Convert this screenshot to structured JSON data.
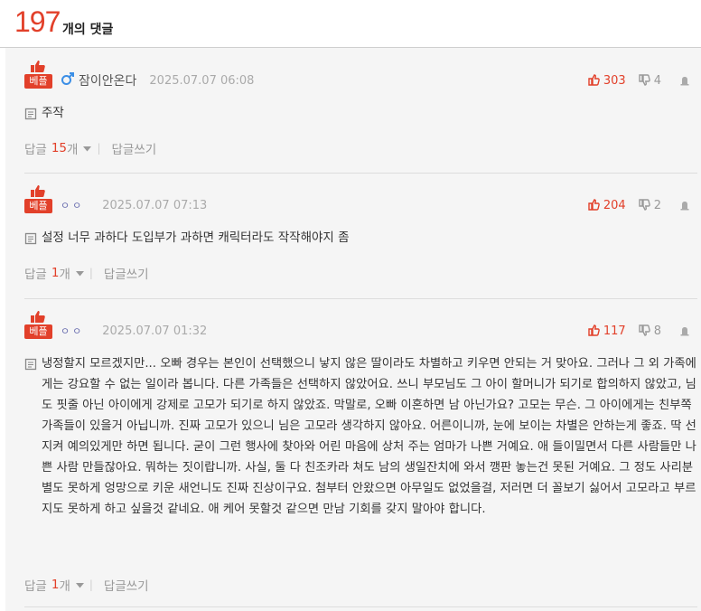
{
  "header": {
    "count": "197",
    "count_label": "개의 댓글"
  },
  "comments": [
    {
      "badge": "베플",
      "author": "잠이안온다",
      "author_gender": "male",
      "date": "2025.07.07 06:08",
      "up": "303",
      "down": "4",
      "text": "주작",
      "reply_label": "답글",
      "reply_count": "15",
      "reply_unit": "개",
      "write_label": "답글쓰기"
    },
    {
      "badge": "베플",
      "author": "ㅇㅇ",
      "date": "2025.07.07 07:13",
      "up": "204",
      "down": "2",
      "text": "설정 너무 과하다 도입부가 과하면 캐릭터라도 작작해야지 좀",
      "reply_label": "답글",
      "reply_count": "1",
      "reply_unit": "개",
      "write_label": "답글쓰기"
    },
    {
      "badge": "베플",
      "author": "ㅇㅇ",
      "date": "2025.07.07 01:32",
      "up": "117",
      "down": "8",
      "text": "냉정할지 모르겠지만... 오빠 경우는 본인이 선택했으니 낳지 않은 딸이라도 차별하고 키우면 안되는 거 맞아요. 그러나 그 외 가족에게는 강요할 수 없는 일이라 봅니다. 다른 가족들은 선택하지 않았어요. 쓰니 부모님도 그 아이 할머니가 되기로 합의하지 않았고, 님도 핏줄 아닌 아이에게 강제로 고모가 되기로 하지 않았죠. 막말로, 오빠 이혼하면 남 아닌가요? 고모는 무슨. 그 아이에게는 친부쪽 가족들이 있을거 아닙니까. 진짜 고모가 있으니 님은 고모라 생각하지 않아요. 어른이니까, 눈에 보이는 차별은 안하는게 좋죠. 딱 선 지켜 예의있게만 하면 됩니다. 굳이 그런 행사에 찾아와 어린 마음에 상처 주는 엄마가 나쁜 거예요. 애 들이밀면서 다른 사람들만 나쁜 사람 만들잖아요. 뭐하는 짓이랍니까. 사실, 둘 다 친조카라 쳐도 남의 생일잔치에 와서 깽판 놓는건 못된 거예요. 그 정도 사리분별도 못하게 엉망으로 키운 새언니도 진짜 진상이구요. 첨부터 안왔으면 아무일도 없었을걸, 저러면 더 꼴보기 싫어서 고모라고 부르지도 못하게 하고 싶을것 같네요. 애 케어 못할것 같으면 만남 기회를 갖지 말아야 합니다.",
      "reply_label": "답글",
      "reply_count": "1",
      "reply_unit": "개",
      "write_label": "답글쓰기"
    }
  ],
  "colors": {
    "accent": "#e2402a",
    "male_icon": "#3a8ee6",
    "dots": "#6b6fb0"
  }
}
